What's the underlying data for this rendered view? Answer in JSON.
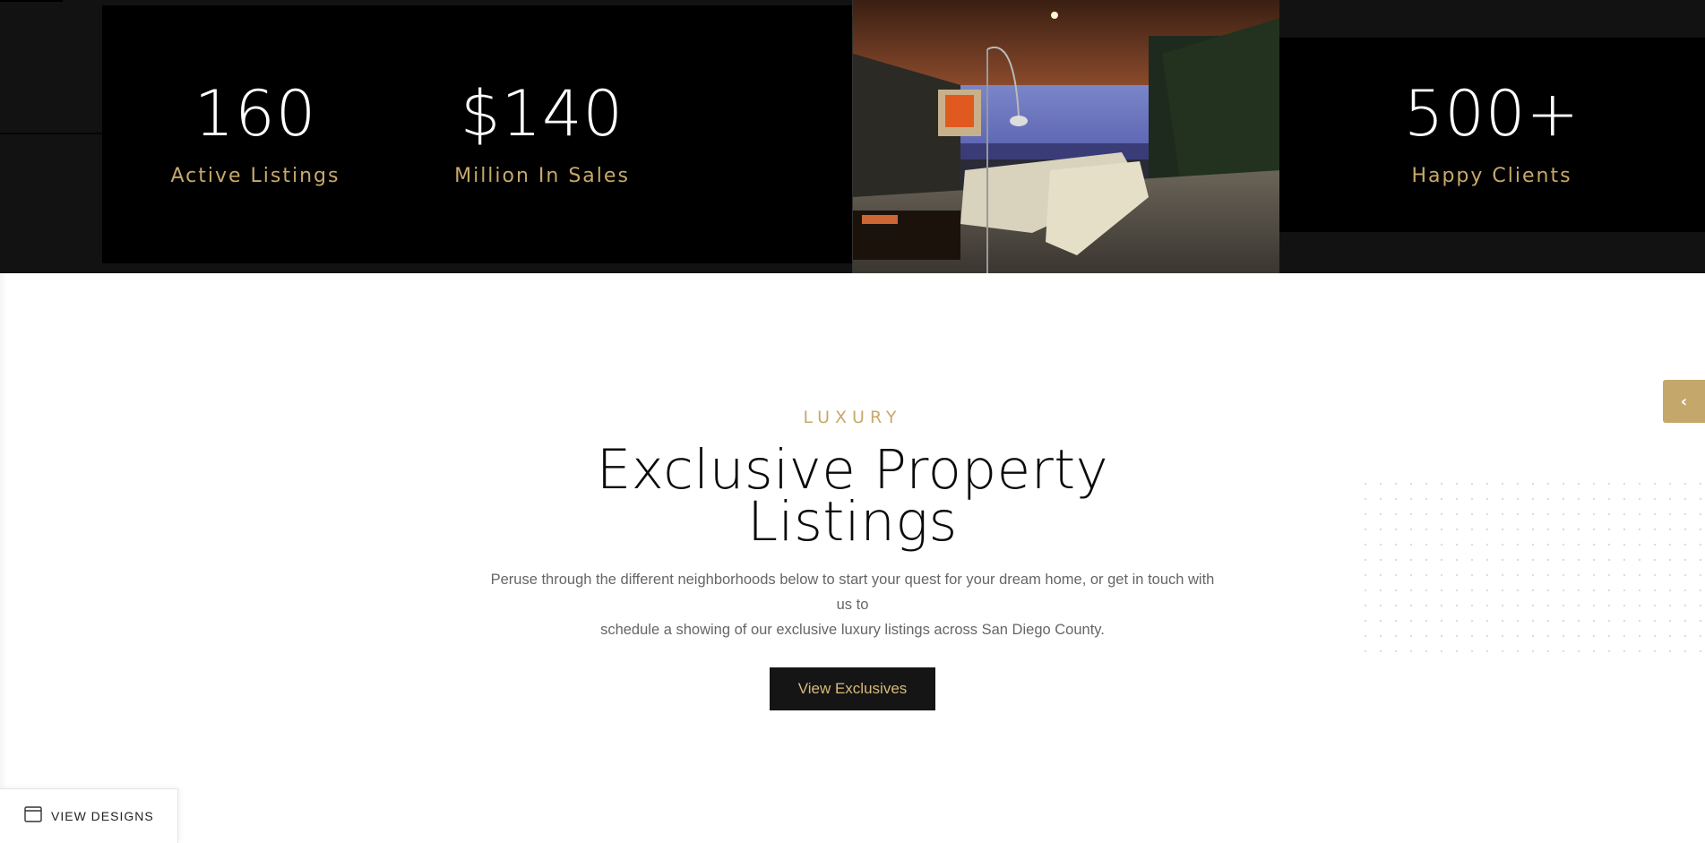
{
  "stats": {
    "listings": {
      "value": "160",
      "label": "Active Listings"
    },
    "sales": {
      "value": "$140",
      "label": "Million In Sales"
    },
    "clients": {
      "value": "500+",
      "label": "Happy Clients"
    }
  },
  "luxury": {
    "eyebrow": "LUXURY",
    "headline_line1": "Exclusive Property",
    "headline_line2": "Listings",
    "lede_line1": "Peruse through the different neighborhoods below to start your quest for your dream home, or get in touch with us to",
    "lede_line2": "schedule a showing of our exclusive luxury listings across San Diego County.",
    "cta_label": "View Exclusives"
  },
  "side_tab": {
    "icon": "chevron-left-icon",
    "glyph": "‹"
  },
  "view_designs": {
    "label": "VIEW DESIGNS",
    "icon": "browser-window-icon"
  },
  "colors": {
    "gold": "#c7a96a",
    "gold_tab": "#c4a76b",
    "band_dark": "#121212",
    "black": "#000000",
    "button_dark": "#151515",
    "body_text": "#666666"
  }
}
